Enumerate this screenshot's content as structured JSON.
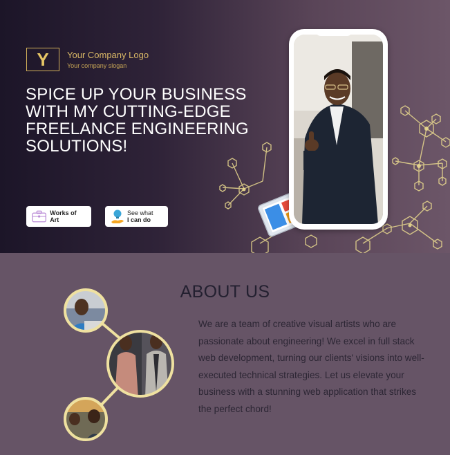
{
  "brand": {
    "logo_letter": "Y",
    "name": "Your Company Logo",
    "slogan": "Your company slogan",
    "colors": {
      "gold": "#d9b866",
      "hex_accent": "#e8d88e",
      "ring": "#efe1a0"
    }
  },
  "hero": {
    "headline": "SPICE UP YOUR BUSINESS WITH MY CUTTING-EDGE FREELANCE ENGINEERING SOLUTIONS!",
    "buttons": [
      {
        "label_pre": "Works of ",
        "label_bold": "Art",
        "icon": "briefcase-icon"
      },
      {
        "label_line1": "See what",
        "label_line2": "I can do",
        "icon": "lightbulb-hand-icon"
      }
    ],
    "phone_image": "man-giving-thumbs-up-photo",
    "decoration": "hexagon-molecule-network"
  },
  "about": {
    "title": "ABOUT US",
    "text": "We are a team of creative visual artists who are passionate about engineering! We excel in full stack web development, turning our clients' visions into well-executed technical strategies. Let us elevate your business with a stunning web application that strikes the perfect chord!",
    "photos": [
      "man-with-laptop-photo",
      "two-men-standing-photo",
      "team-at-laptop-photo"
    ]
  }
}
